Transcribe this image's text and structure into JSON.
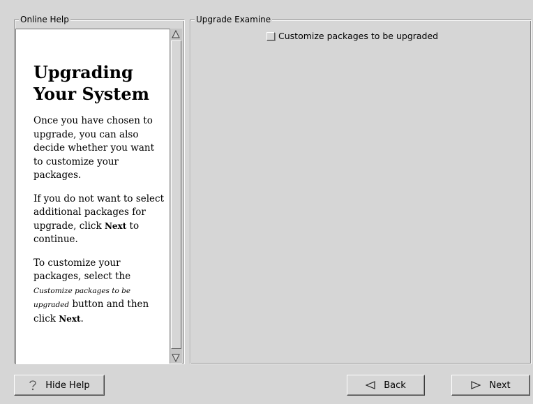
{
  "help_panel": {
    "frame_title": "Online Help",
    "heading": "Upgrading Your System",
    "paragraph1": "Once you have chosen to upgrade, you can also decide whether you want to customize your packages.",
    "paragraph2_before": "If you do not want to select additional packages for upgrade, click ",
    "paragraph2_bold": "Next",
    "paragraph2_after": " to continue.",
    "paragraph3_before": "To customize your packages, select the ",
    "paragraph3_italic": "Customize packages to be upgraded",
    "paragraph3_middle": " button and then click ",
    "paragraph3_bold": "Next",
    "paragraph3_after": "."
  },
  "upgrade_panel": {
    "frame_title": "Upgrade Examine",
    "customize_checkbox": {
      "label": "Customize packages to be upgraded",
      "checked": false
    }
  },
  "buttons": {
    "hide_help": "Hide Help",
    "back": "Back",
    "next": "Next"
  },
  "icons": {
    "hide_help": "question-mark-icon",
    "back": "left-triangle-icon",
    "next": "right-triangle-icon",
    "scroll_up": "up-arrow-icon",
    "scroll_down": "down-arrow-icon"
  },
  "colors": {
    "background": "#d6d6d6",
    "help_background": "#ffffff"
  }
}
